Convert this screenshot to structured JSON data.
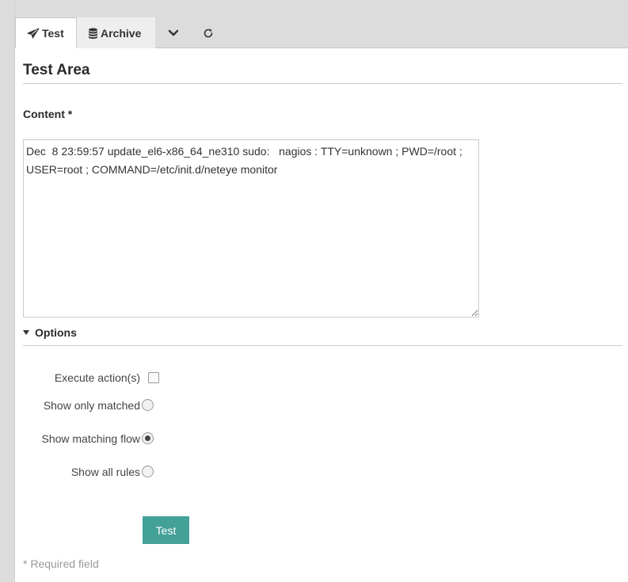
{
  "tabs": {
    "test_label": "Test",
    "archive_label": "Archive"
  },
  "header": {
    "title": "Test Area"
  },
  "content_field": {
    "label": "Content *",
    "value": "Dec  8 23:59:57 update_el6-x86_64_ne310 sudo:   nagios : TTY=unknown ; PWD=/root ; USER=root ; COMMAND=/etc/init.d/neteye monitor"
  },
  "options": {
    "toggle_label": "Options",
    "execute_actions_label": "Execute action(s)",
    "show_only_matched_label": "Show only matched",
    "show_matching_flow_label": "Show matching flow",
    "show_all_rules_label": "Show all rules",
    "selected_view": "show_matching_flow",
    "execute_actions_checked": false
  },
  "form": {
    "submit_label": "Test",
    "required_note": "* Required field"
  },
  "colors": {
    "accent": "#44a198",
    "background": "#dcdcdc"
  },
  "icons": {
    "test_tab": "paper-plane-icon",
    "archive_tab": "database-icon",
    "dropdown": "chevron-down-icon",
    "refresh": "refresh-icon"
  }
}
